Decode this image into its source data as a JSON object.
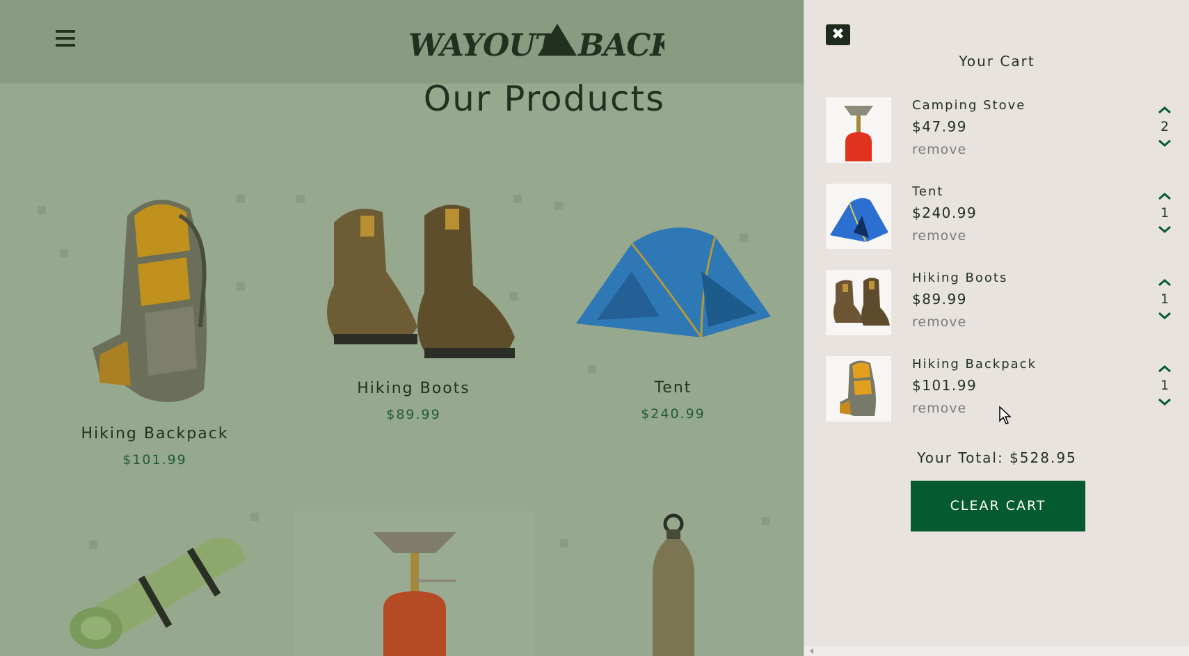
{
  "header": {
    "logo_text_left": "WAYOUT",
    "logo_text_right": "BACK",
    "menu_icon": "hamburger-icon"
  },
  "main": {
    "title": "Our Products",
    "products": [
      {
        "name": "Hiking Backpack",
        "price": "$101.99",
        "image": "backpack"
      },
      {
        "name": "Hiking Boots",
        "price": "$89.99",
        "image": "boots"
      },
      {
        "name": "Tent",
        "price": "$240.99",
        "image": "tent"
      },
      {
        "name": "",
        "price": "",
        "image": "sleeping-mat"
      },
      {
        "name": "",
        "price": "",
        "image": "camping-stove"
      },
      {
        "name": "",
        "price": "",
        "image": "water-bottle"
      }
    ]
  },
  "cart": {
    "close_icon": "close-icon",
    "title": "Your Cart",
    "remove_label": "remove",
    "items": [
      {
        "name": "Camping Stove",
        "price": "$47.99",
        "qty": "2",
        "image": "camping-stove"
      },
      {
        "name": "Tent",
        "price": "$240.99",
        "qty": "1",
        "image": "tent"
      },
      {
        "name": "Hiking Boots",
        "price": "$89.99",
        "qty": "1",
        "image": "boots"
      },
      {
        "name": "Hiking Backpack",
        "price": "$101.99",
        "qty": "1",
        "image": "backpack"
      }
    ],
    "total_label": "Your Total: $528.95",
    "clear_label": "CLEAR CART"
  },
  "colors": {
    "primary_dark": "#22311f",
    "accent_green": "#055a2f",
    "price_green": "#215c33",
    "overlay": "#96a98f",
    "drawer_bg": "#e8e3de"
  }
}
